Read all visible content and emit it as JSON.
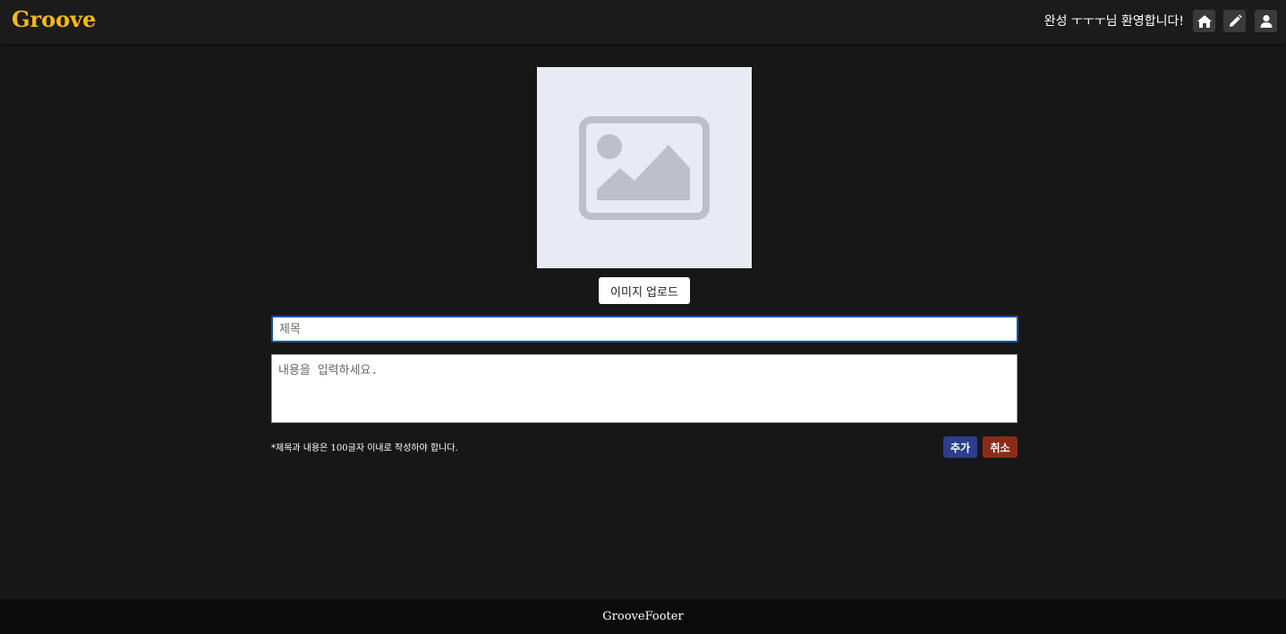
{
  "header": {
    "logo": "Groove",
    "welcome": "완성 ㅜㅜㅜ님 환영합니다!",
    "icons": [
      "home-icon",
      "pencil-icon",
      "user-icon"
    ]
  },
  "form": {
    "image_upload_label": "이미지 업로드",
    "image_placeholder_icon": "image-placeholder-icon",
    "title_placeholder": "제목",
    "title_value": "",
    "content_placeholder": "내용을 입력하세요.",
    "content_value": "",
    "notice": "*제목과 내용은 100글자 이내로 작성하야 합니다.",
    "add_label": "추가",
    "cancel_label": "취소"
  },
  "footer": {
    "text": "GrooveFooter"
  },
  "colors": {
    "background": "#171717",
    "logo": "#f5b914",
    "add_button": "#2b3d8c",
    "cancel_button": "#8a2b1a",
    "focus_border": "#1a4fa3"
  }
}
